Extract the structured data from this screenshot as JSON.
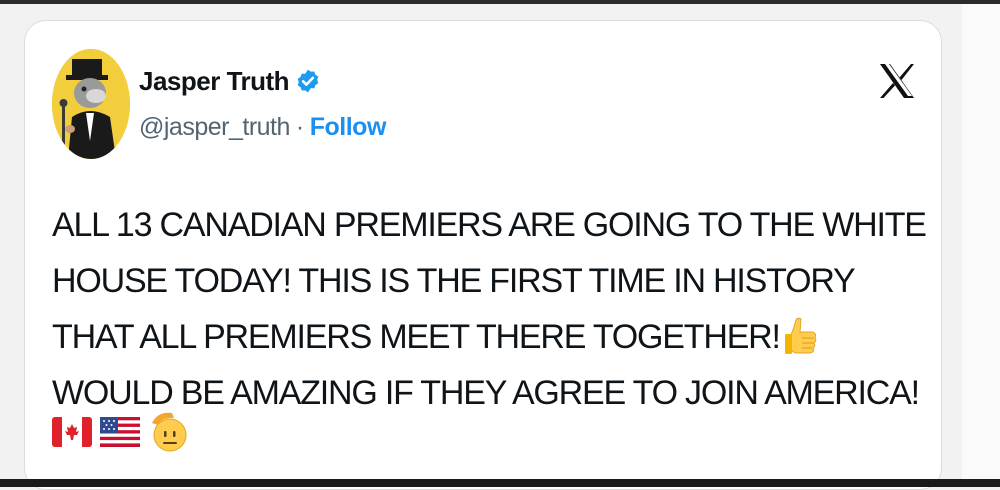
{
  "tweet": {
    "display_name": "Jasper Truth",
    "handle": "@jasper_truth",
    "separator": "·",
    "follow_label": "Follow",
    "lines": [
      "ALL 13 CANADIAN PREMIERS ARE GOING TO THE WHITE",
      "HOUSE TODAY! THIS IS THE FIRST TIME IN HISTORY",
      "THAT ALL PREMIERS MEET THERE TOGETHER!",
      "WOULD BE AMAZING IF THEY AGREE TO JOIN AMERICA!"
    ],
    "emojis": [
      "thumbs-up",
      "canada-flag",
      "us-flag",
      "saluting-face"
    ]
  },
  "icons": {
    "verified": "verified-badge-icon",
    "platform": "x-logo-icon"
  },
  "colors": {
    "accent": "#1d8ff0",
    "text": "#0f1419",
    "secondary": "#536471",
    "verified": "#1d9bf0"
  }
}
